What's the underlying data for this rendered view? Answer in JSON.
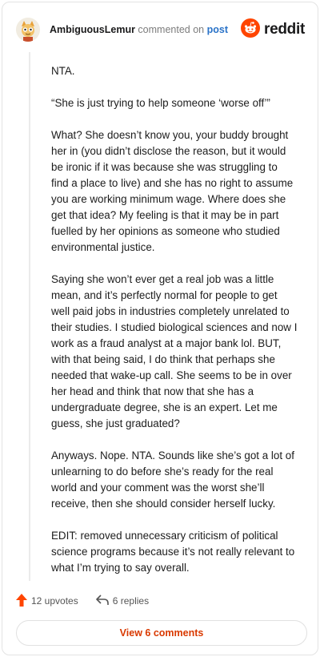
{
  "header": {
    "username": "AmbiguousLemur",
    "action_text": " commented on ",
    "post_link": "post",
    "brand": "reddit"
  },
  "comment": {
    "paragraphs": [
      "NTA.",
      "“She is just trying to help someone ‘worse off’”",
      "What? She doesn’t know you, your buddy brought her in (you didn’t disclose the reason, but it would be ironic if it was because she was struggling to find a place to live) and she has no right to assume you are working minimum wage. Where does she get that idea? My feeling is that it may be in part fuelled by her opinions as someone who studied environmental justice.",
      "Saying she won’t ever get a real job was a little mean, and it’s perfectly normal for people to get well paid jobs in industries completely unrelated to their studies. I studied biological sciences and now I work as a fraud analyst at a major bank lol. BUT, with that being said, I do think that perhaps she needed that wake-up call. She seems to be in over her head and think that now that she has a undergraduate degree, she is an expert. Let me guess, she just graduated?",
      "Anyways. Nope. NTA. Sounds like she’s got a lot of unlearning to do before she’s ready for the real world and your comment was the worst she’ll receive, then she should consider herself lucky.",
      "EDIT: removed unnecessary criticism of political science programs because it’s not really relevant to what I’m trying to say overall."
    ]
  },
  "actions": {
    "upvotes": "12 upvotes",
    "replies": "6 replies"
  },
  "footer": {
    "view_comments": "View 6 comments"
  },
  "icons": {
    "upvote": "upvote-arrow-icon",
    "reply": "reply-arrow-icon",
    "brand": "reddit-snoo-icon",
    "avatar": "lemur-avatar-icon"
  },
  "colors": {
    "accent": "#ff4500",
    "link": "#2a73c8",
    "button_text": "#d93900"
  }
}
